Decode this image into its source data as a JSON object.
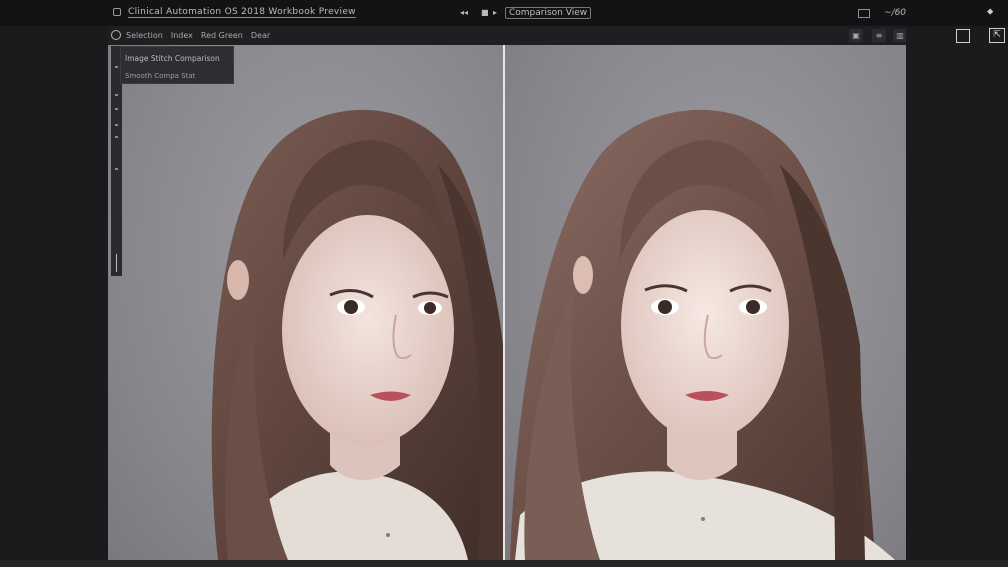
{
  "window": {
    "title": "Clinical Automation OS 2018 Workbook Preview",
    "controls": [
      "◂◂",
      "■",
      "▸"
    ],
    "zoom": "Comparison View",
    "right_label": "~/60",
    "right_glyph": "⬥"
  },
  "toolbar": {
    "menu": [
      "Selection",
      "Index",
      "Red Green",
      "Dear"
    ],
    "buttons": [
      "▣",
      "≡",
      "▥"
    ]
  },
  "info_panel": {
    "line1": "Image Stitch Comparison",
    "line2": "Smooth Compa Stat"
  },
  "right_strip": {
    "expand_glyph": "⇱"
  },
  "icons": {
    "app": "app-icon",
    "frame": "frame-toggle-icon",
    "expand": "expand-icon"
  },
  "colors": {
    "background": "#1b1c1e",
    "canvas": "#8c8b90",
    "divider": "#e6e6e6",
    "hair": "#6b4f47",
    "skin": "#ead7d2",
    "sweater": "#e6e1da"
  }
}
